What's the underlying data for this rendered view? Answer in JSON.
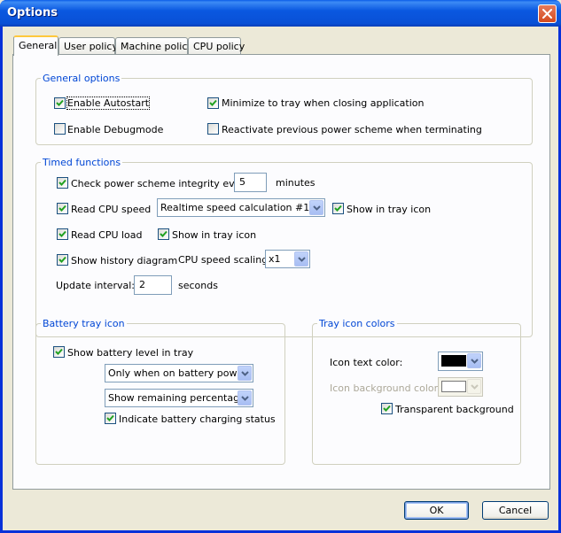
{
  "window": {
    "title": "Options"
  },
  "tabs": [
    "General",
    "User policy",
    "Machine policy",
    "CPU policy"
  ],
  "general_options": {
    "legend": "General options",
    "enable_autostart": {
      "label": "Enable Autostart",
      "checked": true
    },
    "minimize_to_tray": {
      "label": "Minimize to tray when closing application",
      "checked": true
    },
    "enable_debugmode": {
      "label": "Enable Debugmode",
      "checked": false
    },
    "reactivate_scheme": {
      "label": "Reactivate previous power scheme when terminating",
      "checked": false
    }
  },
  "timed_functions": {
    "legend": "Timed functions",
    "check_integrity": {
      "label": "Check power scheme integrity every",
      "checked": true,
      "value": "5",
      "unit": "minutes"
    },
    "read_cpu_speed": {
      "label": "Read CPU speed",
      "checked": true,
      "method": "Realtime speed calculation #1"
    },
    "speed_show_in_tray": {
      "label": "Show in tray icon",
      "checked": true
    },
    "read_cpu_load": {
      "label": "Read CPU load",
      "checked": true
    },
    "load_show_in_tray": {
      "label": "Show in tray icon",
      "checked": true
    },
    "show_history": {
      "label": "Show history diagram",
      "checked": true
    },
    "cpu_speed_scaling": {
      "label": "CPU speed scaling:",
      "value": "x1"
    },
    "update_interval": {
      "label": "Update interval:",
      "value": "2",
      "unit": "seconds"
    }
  },
  "battery_tray_icon": {
    "legend": "Battery tray icon",
    "show_battery_level": {
      "label": "Show battery level in tray",
      "checked": true
    },
    "when_option": "Only when on battery power",
    "display_option": "Show remaining percentage",
    "indicate_charging": {
      "label": "Indicate battery charging status",
      "checked": true
    }
  },
  "tray_icon_colors": {
    "legend": "Tray icon colors",
    "text_color": {
      "label": "Icon text color:",
      "value": "#000000"
    },
    "background_color": {
      "label": "Icon background color:",
      "value": "#FFFFFF"
    },
    "transparent_background": {
      "label": "Transparent background",
      "checked": true
    }
  },
  "buttons": {
    "ok": "OK",
    "cancel": "Cancel"
  },
  "colors": {
    "title_bar": "#0A58E0",
    "legend": "#0046D5",
    "dialog_bg": "#ECE9D8",
    "panel_bg": "#FCFCFE"
  }
}
